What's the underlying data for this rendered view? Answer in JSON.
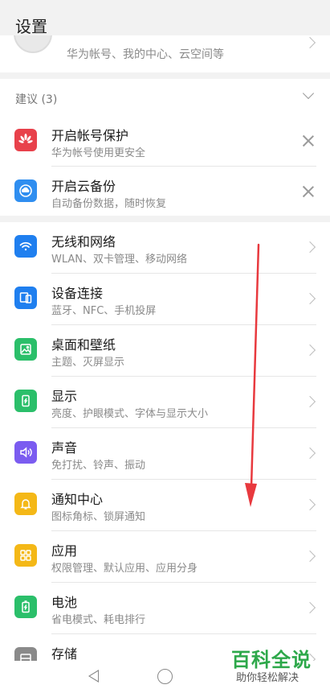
{
  "header": {
    "title": "设置"
  },
  "account": {
    "subtitle": "华为帐号、我的中心、云空间等"
  },
  "suggestions": {
    "title": "建议 (3)",
    "items": [
      {
        "title": "开启帐号保护",
        "subtitle": "华为帐号使用更安全",
        "icon": "huawei-logo-icon",
        "color": "#e8414b"
      },
      {
        "title": "开启云备份",
        "subtitle": "自动备份数据，随时恢复",
        "icon": "cloud-backup-icon",
        "color": "#2f8ef0"
      }
    ]
  },
  "settings": {
    "items": [
      {
        "title": "无线和网络",
        "subtitle": "WLAN、双卡管理、移动网络",
        "icon": "wifi-icon",
        "color": "#1f7fef"
      },
      {
        "title": "设备连接",
        "subtitle": "蓝牙、NFC、手机投屏",
        "icon": "device-connect-icon",
        "color": "#1f7fef"
      },
      {
        "title": "桌面和壁纸",
        "subtitle": "主题、灭屏显示",
        "icon": "wallpaper-icon",
        "color": "#2bbf6a"
      },
      {
        "title": "显示",
        "subtitle": "亮度、护眼模式、字体与显示大小",
        "icon": "display-icon",
        "color": "#2bbf6a"
      },
      {
        "title": "声音",
        "subtitle": "免打扰、铃声、振动",
        "icon": "sound-icon",
        "color": "#7b5cf0"
      },
      {
        "title": "通知中心",
        "subtitle": "图标角标、锁屏通知",
        "icon": "bell-icon",
        "color": "#f4b817"
      },
      {
        "title": "应用",
        "subtitle": "权限管理、默认应用、应用分身",
        "icon": "apps-grid-icon",
        "color": "#f4b817"
      },
      {
        "title": "电池",
        "subtitle": "省电模式、耗电排行",
        "icon": "battery-icon",
        "color": "#2bbf6a"
      },
      {
        "title": "存储",
        "subtitle": "",
        "icon": "storage-icon",
        "color": "#8a8a8a"
      }
    ]
  },
  "watermark": {
    "name": "百科全说",
    "tagline": "助你轻松解决"
  },
  "colors": {
    "arrow": "#e8393e",
    "background": "#f2f2f2"
  }
}
